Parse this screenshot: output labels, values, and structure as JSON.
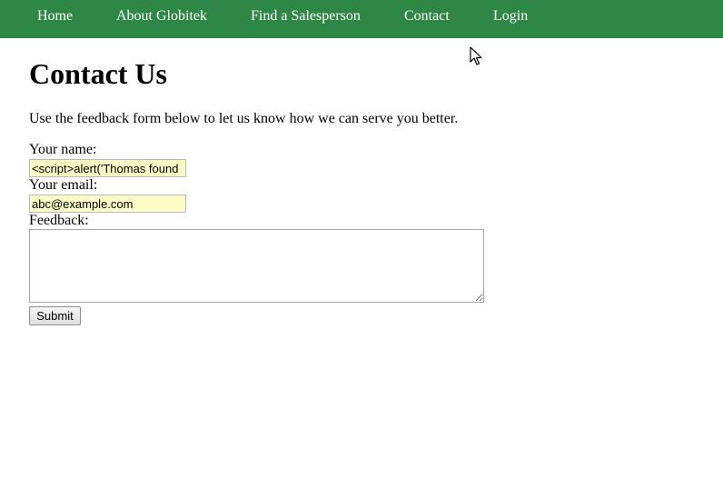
{
  "nav": {
    "items": [
      {
        "label": "Home"
      },
      {
        "label": "About Globitek"
      },
      {
        "label": "Find a Salesperson"
      },
      {
        "label": "Contact"
      },
      {
        "label": "Login"
      }
    ]
  },
  "page": {
    "title": "Contact Us",
    "intro": "Use the feedback form below to let us know how we can serve you better."
  },
  "form": {
    "name_label": "Your name:",
    "name_value": "<script>alert('Thomas found",
    "email_label": "Your email:",
    "email_value": "abc@example.com",
    "feedback_label": "Feedback:",
    "feedback_value": "",
    "submit_label": "Submit"
  },
  "colors": {
    "nav_background": "#2e8745",
    "input_autofill": "#fbfcc6"
  },
  "icons": {
    "pointer": "mouse-pointer-icon"
  }
}
